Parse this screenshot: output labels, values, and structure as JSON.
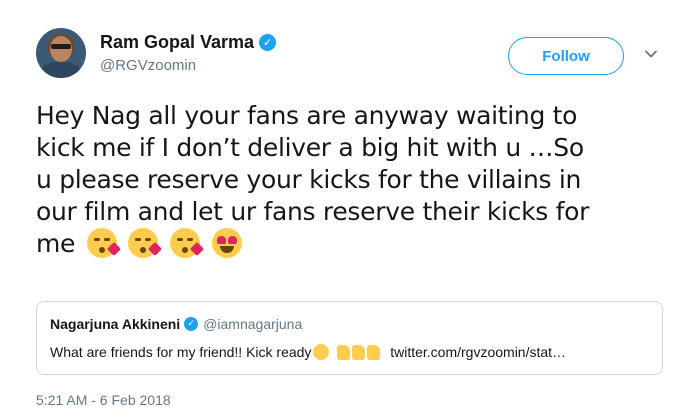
{
  "author": {
    "display_name": "Ram Gopal Varma",
    "handle": "@RGVzoomin",
    "verified_icon": "verified-badge-icon"
  },
  "actions": {
    "follow_label": "Follow",
    "caret_icon": "chevron-down-icon"
  },
  "tweet": {
    "line1": "Hey Nag all your fans are anyway waiting to",
    "line2": "kick me if I don’t deliver a big hit with u …So",
    "line3": "u please reserve your kicks for the villains in",
    "line4": "our film and let ur fans reserve their kicks for",
    "line5": "me",
    "emojis": [
      "kissing-heart-emoji",
      "kissing-heart-emoji",
      "kissing-heart-emoji",
      "heart-eyes-emoji"
    ]
  },
  "quote": {
    "display_name": "Nagarjuna Akkineni",
    "handle": "@iamnagarjuna",
    "text": "What are friends for my friend!! Kick ready",
    "link": "twitter.com/rgvzoomin/stat…",
    "emojis": [
      "laughing-emoji",
      "thumbs-up-emoji",
      "thumbs-up-emoji",
      "thumbs-up-emoji"
    ]
  },
  "timestamp": "5:21 AM - 6 Feb 2018",
  "colors": {
    "accent": "#1da1f2",
    "text": "#14171a",
    "secondary": "#657786",
    "border": "#ccd6dd",
    "emoji": "#ffcc4d",
    "heart": "#e0245e"
  }
}
